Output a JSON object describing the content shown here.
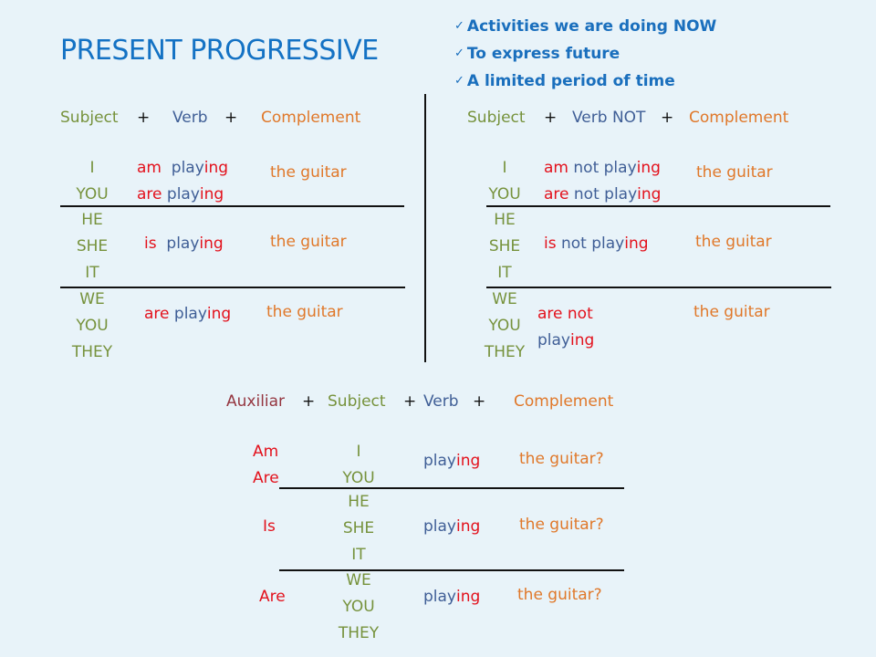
{
  "title": "PRESENT PROGRESSIVE",
  "uses": [
    {
      "icon": "check-icon",
      "text": "Activities we are doing NOW"
    },
    {
      "icon": "check-icon",
      "text": "To express future"
    },
    {
      "icon": "check-icon",
      "text": "A limited period of time"
    }
  ],
  "colors": {
    "title": "#1472c4",
    "subject": "#76923c",
    "verb": "#3f5e96",
    "complement": "#e0782a",
    "auxiliary": "#e3111c",
    "auxiliar_header": "#953640",
    "background": "#e8f3f9"
  },
  "affirmative": {
    "header": {
      "subject": "Subject",
      "plus1": "+",
      "verb": "Verb",
      "plus2": "+",
      "complement": "Complement"
    },
    "rows": [
      {
        "subjects": [
          "I",
          "YOU"
        ],
        "verbs": [
          {
            "aux": "am",
            "base": "play",
            "ing": "ing"
          },
          {
            "aux": "are",
            "base": "play",
            "ing": "ing"
          }
        ],
        "complement": "the guitar"
      },
      {
        "subjects": [
          "HE",
          "SHE",
          "IT"
        ],
        "verbs": [
          {
            "aux": "is",
            "base": "play",
            "ing": "ing"
          }
        ],
        "complement": "the guitar"
      },
      {
        "subjects": [
          "WE",
          "YOU",
          "THEY"
        ],
        "verbs": [
          {
            "aux": "are",
            "base": "play",
            "ing": "ing"
          }
        ],
        "complement": "the guitar"
      }
    ]
  },
  "negative": {
    "header": {
      "subject": "Subject",
      "plus1": "+",
      "verb": "Verb NOT",
      "plus2": "+",
      "complement": "Complement"
    },
    "rows": [
      {
        "subjects": [
          "I",
          "YOU"
        ],
        "verbs": [
          {
            "aux": "am",
            "not": "not",
            "base": "play",
            "ing": "ing"
          },
          {
            "aux": "are",
            "not": "not",
            "base": "play",
            "ing": "ing"
          }
        ],
        "complement": "the guitar"
      },
      {
        "subjects": [
          "HE",
          "SHE",
          "IT"
        ],
        "verbs": [
          {
            "aux": "is",
            "not": "not",
            "base": "play",
            "ing": "ing"
          }
        ],
        "complement": "the guitar"
      },
      {
        "subjects": [
          "WE",
          "YOU",
          "THEY"
        ],
        "verbs": [
          {
            "aux": "are not",
            "base": "play",
            "ing": "ing"
          }
        ],
        "complement": "the guitar"
      }
    ]
  },
  "interrogative": {
    "header": {
      "auxiliar": "Auxiliar",
      "plus1": "+",
      "subject": "Subject",
      "plus2": "+",
      "verb": "Verb",
      "plus3": "+",
      "complement": "Complement"
    },
    "rows": [
      {
        "aux": [
          "Am",
          "Are"
        ],
        "subjects": [
          "I",
          "YOU"
        ],
        "verb": {
          "base": "play",
          "ing": "ing"
        },
        "complement": "the guitar?"
      },
      {
        "aux": [
          "Is"
        ],
        "subjects": [
          "HE",
          "SHE",
          "IT"
        ],
        "verb": {
          "base": "play",
          "ing": "ing"
        },
        "complement": "the guitar?"
      },
      {
        "aux": [
          "Are"
        ],
        "subjects": [
          "WE",
          "YOU",
          "THEY"
        ],
        "verb": {
          "base": "play",
          "ing": "ing"
        },
        "complement": "the guitar?"
      }
    ]
  }
}
